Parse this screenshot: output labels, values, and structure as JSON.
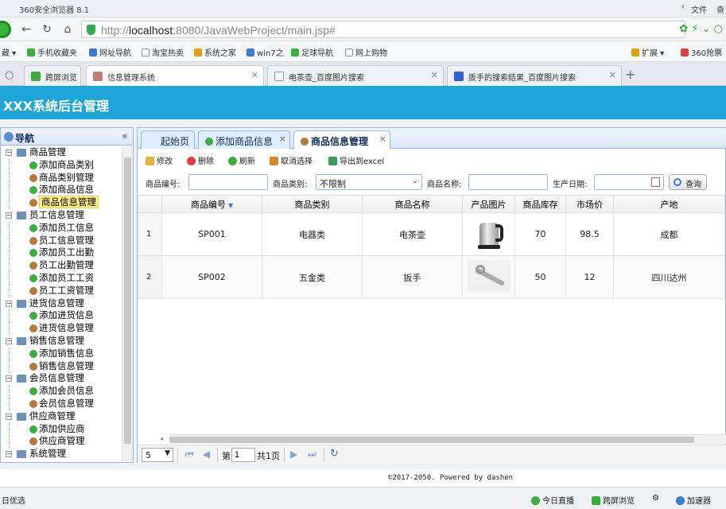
{
  "browser": {
    "app_title": "360安全浏览器 8.1",
    "menu_file": "文件",
    "menu_view": "查",
    "url_prefix": "http://",
    "url_host": "localhost",
    "url_rest": ":8080/JavaWebProject/main.jsp#",
    "bookmarks": [
      "藏",
      "手机收藏夹",
      "网址导航",
      "淘宝热卖",
      "系统之家",
      "win7之",
      "足球导航",
      "网上购物",
      "扩展",
      "360抢票"
    ],
    "tabs": [
      {
        "label": "跨屏浏览"
      },
      {
        "label": "信息管理系统"
      },
      {
        "label": "电茶壶_百度图片搜索"
      },
      {
        "label": "扳手的搜索结果_百度图片搜索"
      }
    ]
  },
  "app": {
    "title": "XXX系统后台管理",
    "nav_title": "导航",
    "tree": [
      {
        "label": "商品管理",
        "level": 0
      },
      {
        "label": "添加商品类别",
        "level": 1,
        "icon": "add"
      },
      {
        "label": "商品类别管理",
        "level": 1,
        "icon": "user"
      },
      {
        "label": "添加商品信息",
        "level": 1,
        "icon": "add"
      },
      {
        "label": "商品信息管理",
        "level": 1,
        "icon": "user",
        "selected": true
      },
      {
        "label": "员工信息管理",
        "level": 0
      },
      {
        "label": "添加员工信息",
        "level": 1,
        "icon": "add"
      },
      {
        "label": "员工信息管理",
        "level": 1,
        "icon": "user"
      },
      {
        "label": "添加员工出勤",
        "level": 1,
        "icon": "add"
      },
      {
        "label": "员工出勤管理",
        "level": 1,
        "icon": "user"
      },
      {
        "label": "添加员工工资",
        "level": 1,
        "icon": "add"
      },
      {
        "label": "员工工资管理",
        "level": 1,
        "icon": "user"
      },
      {
        "label": "进货信息管理",
        "level": 0
      },
      {
        "label": "添加进货信息",
        "level": 1,
        "icon": "add"
      },
      {
        "label": "进货信息管理",
        "level": 1,
        "icon": "user"
      },
      {
        "label": "销售信息管理",
        "level": 0
      },
      {
        "label": "添加销售信息",
        "level": 1,
        "icon": "add"
      },
      {
        "label": "销售信息管理",
        "level": 1,
        "icon": "user"
      },
      {
        "label": "会员信息管理",
        "level": 0
      },
      {
        "label": "添加会员信息",
        "level": 1,
        "icon": "add"
      },
      {
        "label": "会员信息管理",
        "level": 1,
        "icon": "user"
      },
      {
        "label": "供应商管理",
        "level": 0
      },
      {
        "label": "添加供应商",
        "level": 1,
        "icon": "add"
      },
      {
        "label": "供应商管理",
        "level": 1,
        "icon": "user"
      },
      {
        "label": "系统管理",
        "level": 0
      }
    ],
    "content_tabs": [
      {
        "label": "起始页"
      },
      {
        "label": "添加商品信息"
      },
      {
        "label": "商品信息管理"
      }
    ],
    "toolbar": {
      "edit": "修改",
      "delete": "删除",
      "refresh": "刷新",
      "cancel_select": "取消选择",
      "export": "导出到excel"
    },
    "search": {
      "code_label": "商品编号:",
      "code_value": "",
      "type_label": "商品类别:",
      "type_value": "不限制",
      "name_label": "商品名称:",
      "name_value": "",
      "date_label": "生产日期:",
      "date_value": "",
      "query_button": "查询"
    },
    "grid": {
      "columns": [
        "商品编号",
        "商品类别",
        "商品名称",
        "产品图片",
        "商品库存",
        "市场价",
        "产地"
      ],
      "rows": [
        {
          "rownum": "1",
          "code": "SP001",
          "type": "电器类",
          "name": "电茶壶",
          "stock": "70",
          "price": "98.5",
          "origin": "成都"
        },
        {
          "rownum": "2",
          "code": "SP002",
          "type": "五金类",
          "name": "扳手",
          "stock": "50",
          "price": "12",
          "origin": "四川达州"
        }
      ]
    },
    "pager": {
      "page_size": "5",
      "page_prefix": "第",
      "page_value": "1",
      "page_suffix": "共1页"
    },
    "footer": "©2017-2050. Powered by dashen"
  },
  "status": {
    "left": "日优选",
    "live": "今日直播",
    "cross": "跨屏浏览",
    "accel": "加速器"
  }
}
